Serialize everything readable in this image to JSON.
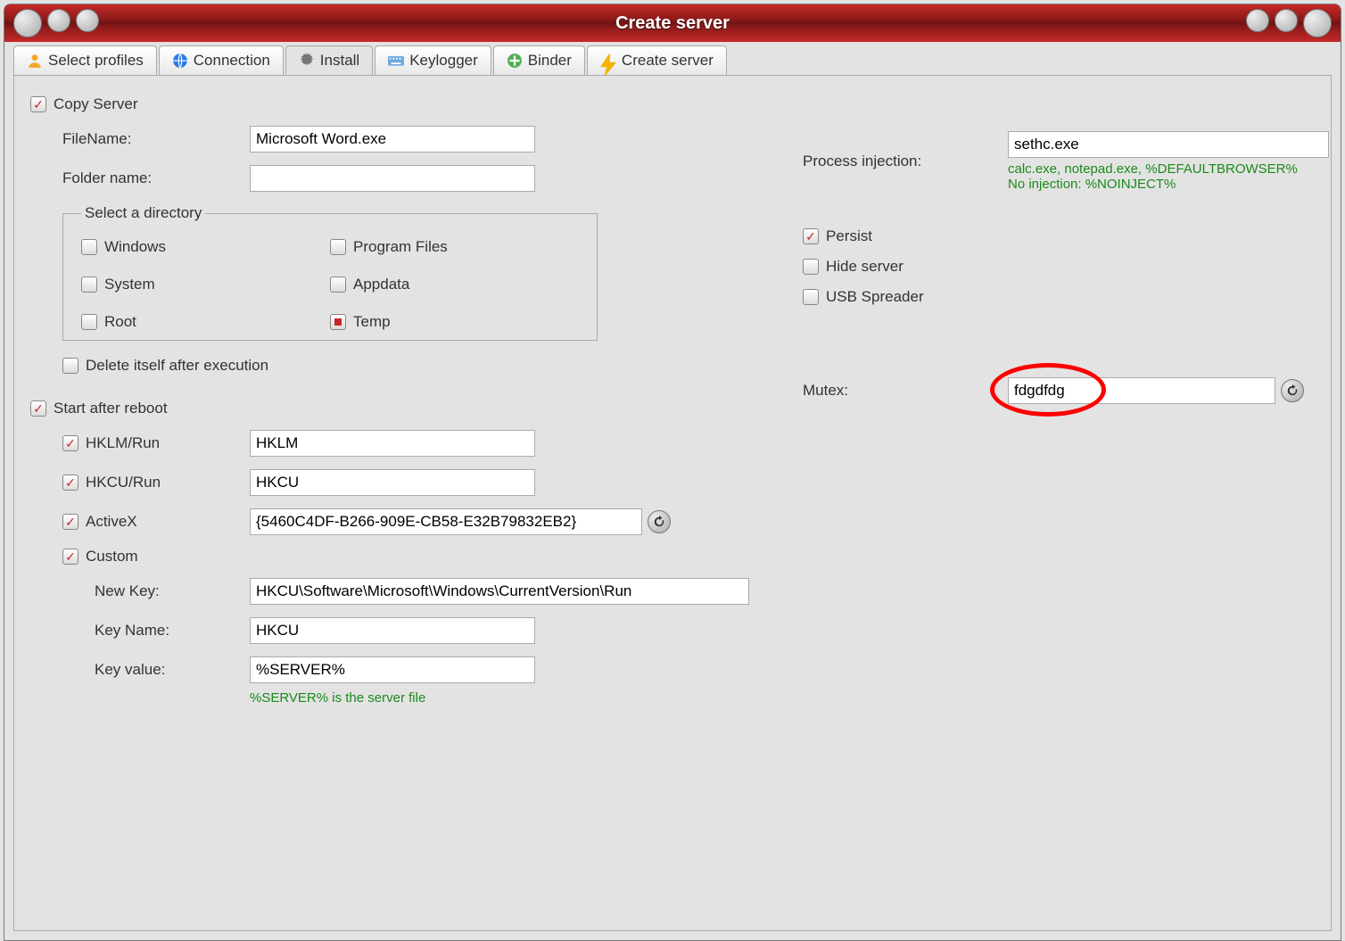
{
  "window": {
    "title": "Create server"
  },
  "tabs": [
    {
      "label": "Select profiles",
      "icon": "user"
    },
    {
      "label": "Connection",
      "icon": "globe"
    },
    {
      "label": "Install",
      "icon": "gear",
      "active": true
    },
    {
      "label": "Keylogger",
      "icon": "keyboard"
    },
    {
      "label": "Binder",
      "icon": "plus"
    },
    {
      "label": "Create server",
      "icon": "bolt"
    }
  ],
  "copy_server": {
    "checkbox_label": "Copy Server",
    "checked": true,
    "filename_label": "FileName:",
    "filename_value": "Microsoft Word.exe",
    "folder_label": "Folder name:",
    "folder_value": "",
    "directory_legend": "Select a directory",
    "dirs": {
      "windows": {
        "label": "Windows",
        "checked": false
      },
      "programfiles": {
        "label": "Program Files",
        "checked": false
      },
      "system": {
        "label": "System",
        "checked": false
      },
      "appdata": {
        "label": "Appdata",
        "checked": false
      },
      "root": {
        "label": "Root",
        "checked": false
      },
      "temp": {
        "label": "Temp",
        "checked": true
      }
    },
    "delete_self": {
      "label": "Delete itself after execution",
      "checked": false
    }
  },
  "process_injection": {
    "label": "Process injection:",
    "value": "sethc.exe",
    "hint1": "calc.exe, notepad.exe, %DEFAULTBROWSER%",
    "hint2": "No injection: %NOINJECT%"
  },
  "options": {
    "persist": {
      "label": "Persist",
      "checked": true
    },
    "hide_server": {
      "label": "Hide server",
      "checked": false
    },
    "usb_spreader": {
      "label": "USB Spreader",
      "checked": false
    }
  },
  "mutex": {
    "label": "Mutex:",
    "value": "fdgdfdg"
  },
  "start_after_reboot": {
    "label": "Start after reboot",
    "checked": true,
    "hklm": {
      "label": "HKLM/Run",
      "checked": true,
      "value": "HKLM"
    },
    "hkcu": {
      "label": "HKCU/Run",
      "checked": true,
      "value": "HKCU"
    },
    "activex": {
      "label": "ActiveX",
      "checked": true,
      "value": "{5460C4DF-B266-909E-CB58-E32B79832EB2}"
    },
    "custom": {
      "label": "Custom",
      "checked": true,
      "newkey_label": "New Key:",
      "newkey_value": "HKCU\\Software\\Microsoft\\Windows\\CurrentVersion\\Run",
      "keyname_label": "Key Name:",
      "keyname_value": "HKCU",
      "keyvalue_label": "Key value:",
      "keyvalue_value": "%SERVER%",
      "keyvalue_hint": "%SERVER% is the server file"
    }
  }
}
